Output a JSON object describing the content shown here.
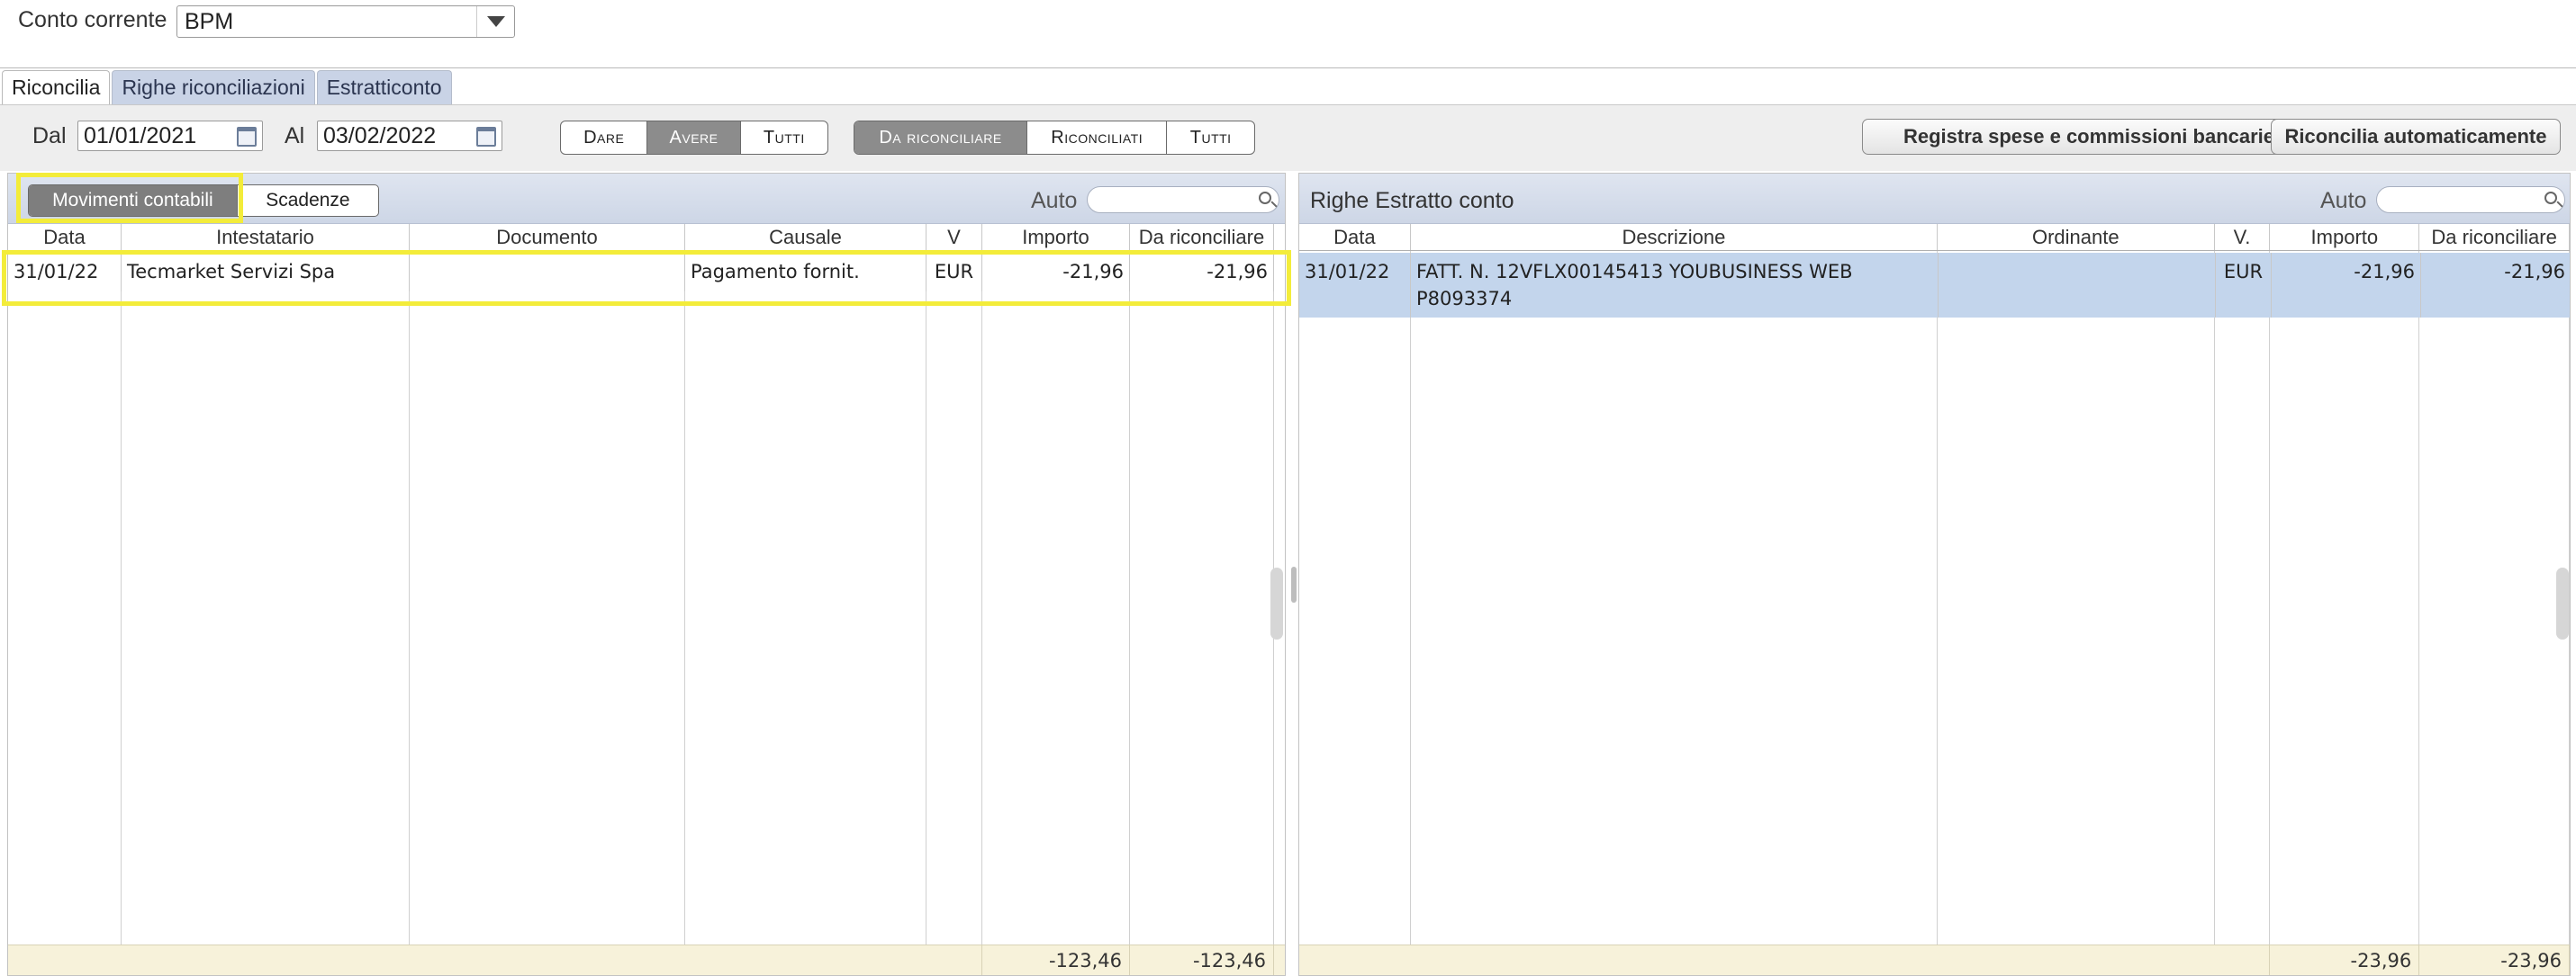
{
  "account": {
    "label": "Conto corrente",
    "value": "BPM"
  },
  "tabs": [
    {
      "label": "Riconcilia",
      "active": true
    },
    {
      "label": "Righe riconciliazioni",
      "active": false
    },
    {
      "label": "Estratticonto",
      "active": false
    }
  ],
  "filters": {
    "from_label": "Dal",
    "from_value": "01/01/2021",
    "to_label": "Al",
    "to_value": "03/02/2022",
    "direction": [
      {
        "label": "Dare"
      },
      {
        "label": "Avere",
        "selected": true
      },
      {
        "label": "Tutti"
      }
    ],
    "status": [
      {
        "label": "Da riconciliare",
        "selected": true
      },
      {
        "label": "Riconciliati"
      },
      {
        "label": "Tutti"
      }
    ]
  },
  "actions": {
    "register_fees": "Registra spese e commissioni bancarie",
    "auto_reconcile": "Riconcilia automaticamente"
  },
  "left_panel": {
    "toggle": [
      {
        "label": "Movimenti contabili",
        "selected": true
      },
      {
        "label": "Scadenze"
      }
    ],
    "auto_label": "Auto",
    "columns": [
      "Data",
      "Intestatario",
      "Documento",
      "Causale",
      "V",
      "Importo",
      "Da riconciliare"
    ],
    "rows": [
      {
        "data": "31/01/22",
        "intestatario": "Tecmarket Servizi Spa",
        "documento": "",
        "causale": "Pagamento fornit.",
        "v": "EUR",
        "importo": "-21,96",
        "da_riconciliare": "-21,96"
      }
    ],
    "totals": {
      "importo": "-123,46",
      "da_riconciliare": "-123,46"
    }
  },
  "right_panel": {
    "title": "Righe Estratto conto",
    "auto_label": "Auto",
    "columns": [
      "Data",
      "Descrizione",
      "Ordinante",
      "V.",
      "Importo",
      "Da riconciliare"
    ],
    "rows": [
      {
        "data": "31/01/22",
        "descrizione_line1": "FATT. N. 12VFLX00145413 YOUBUSINESS WEB",
        "descrizione_line2": "P8093374",
        "ordinante": "",
        "v": "EUR",
        "importo": "-21,96",
        "da_riconciliare": "-21,96"
      }
    ],
    "totals": {
      "importo": "-23,96",
      "da_riconciliare": "-23,96"
    }
  },
  "colors": {
    "tab_inactive": "#c9d3e6",
    "panel_header": "#cdd6e6",
    "selected_row": "#c3d5ec",
    "footer": "#f7f2da",
    "highlight": "#f3ec3a"
  }
}
